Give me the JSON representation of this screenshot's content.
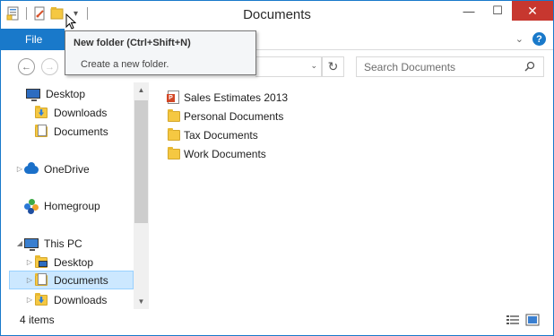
{
  "window": {
    "title": "Documents",
    "controls": {
      "minimize": "—",
      "maximize": "☐",
      "close": "✕"
    }
  },
  "quick_access": {
    "icons": [
      "properties-icon",
      "new-folder-icon",
      "customize-qat-icon"
    ],
    "dropdown_glyph": "▾"
  },
  "ribbon": {
    "file_tab": "File",
    "expand_glyph": "⌄",
    "help_glyph": "?"
  },
  "tooltip": {
    "title": "New folder (Ctrl+Shift+N)",
    "description": "Create a new folder."
  },
  "navbar": {
    "back_glyph": "←",
    "forward_glyph": "→",
    "address_dropdown_glyph": "⌄",
    "refresh_glyph": "↻",
    "search_placeholder": "Search Documents"
  },
  "nav_pane": {
    "favorites": [
      {
        "label": "Desktop",
        "icon": "desktop-icon"
      },
      {
        "label": "Downloads",
        "icon": "downloads-icon"
      },
      {
        "label": "Documents",
        "icon": "documents-icon"
      }
    ],
    "onedrive": {
      "label": "OneDrive",
      "icon": "onedrive-icon",
      "expander": "▷"
    },
    "homegroup": {
      "label": "Homegroup",
      "icon": "homegroup-icon"
    },
    "this_pc": {
      "label": "This PC",
      "icon": "computer-icon",
      "expander": "◢",
      "children": [
        {
          "label": "Desktop",
          "icon": "desktop-folder-icon",
          "expander": "▷"
        },
        {
          "label": "Documents",
          "icon": "documents-folder-icon",
          "expander": "▷",
          "selected": true
        },
        {
          "label": "Downloads",
          "icon": "downloads-folder-icon",
          "expander": "▷"
        }
      ]
    },
    "scroll_up": "▲",
    "scroll_down": "▼"
  },
  "files": [
    {
      "name": "Sales Estimates 2013",
      "icon": "powerpoint-file-icon"
    },
    {
      "name": "Personal Documents",
      "icon": "folder-icon"
    },
    {
      "name": "Tax Documents",
      "icon": "folder-icon"
    },
    {
      "name": "Work Documents",
      "icon": "folder-icon"
    }
  ],
  "status": {
    "item_count": "4 items"
  },
  "colors": {
    "accent": "#1979ca",
    "selection": "#cce8ff",
    "close_button": "#c7372f",
    "folder": "#f5c842"
  }
}
